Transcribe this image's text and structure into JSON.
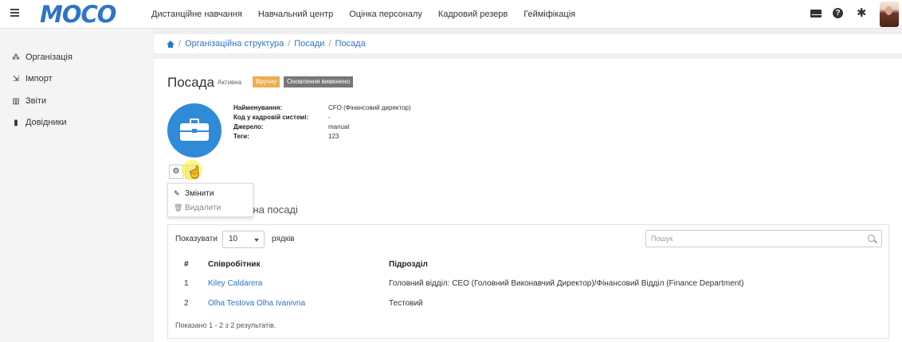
{
  "header": {
    "logo": "MOCO",
    "nav": [
      "Дистанційне навчання",
      "Навчальний центр",
      "Оцінка персоналу",
      "Кадровий резерв",
      "Гейміфікація"
    ],
    "help_glyph": "?",
    "gear_glyph": "✱"
  },
  "sidebar": {
    "items": [
      {
        "label": "Організація",
        "icon": "sitemap-icon",
        "glyph": "⁂"
      },
      {
        "label": "Імпорт",
        "icon": "import-icon",
        "glyph": "⇲"
      },
      {
        "label": "Звіти",
        "icon": "chart-icon",
        "glyph": "▥"
      },
      {
        "label": "Довідники",
        "icon": "book-icon",
        "glyph": "▮"
      }
    ]
  },
  "breadcrumb": {
    "items": [
      "Організаційна структура",
      "Посади",
      "Посада"
    ],
    "separator": "/"
  },
  "position": {
    "title": "Посада",
    "status": "Активна",
    "badge_manual": "Вручну",
    "badge_update": "Оновлення вимкнено",
    "fields": [
      {
        "label": "Найменування:",
        "value": "CFO (Фінансовий директор)"
      },
      {
        "label": "Код у кадровій системі:",
        "value": "-"
      },
      {
        "label": "Джерело:",
        "value": "manual"
      },
      {
        "label": "Теги:",
        "value": "123"
      }
    ]
  },
  "actions": {
    "gear_glyph": "⚙",
    "cursor_glyph": "☝",
    "edit_glyph": "✎",
    "delete_glyph": "🗑",
    "edit": "Змінити",
    "delete": "Видалити"
  },
  "employees": {
    "section_title": "ів на посаді",
    "show_label": "Показувати",
    "page_length": "10",
    "rows_label": "рядків",
    "search_placeholder": "Пошук",
    "columns": [
      "#",
      "Співробітник",
      "Підрозділ"
    ],
    "rows": [
      {
        "num": "1",
        "name": "Kiley Caldarera",
        "dept": "Головний відділ: CEO (Головний Виконавчий Директор)/Фінансовий Відділ (Finance Department)"
      },
      {
        "num": "2",
        "name": "Olha Testova Olha Ivanivna",
        "dept": "Тестовий"
      }
    ],
    "info": "Показано 1 - 2 з 2 результатів."
  },
  "colors": {
    "brand": "#2f74c6",
    "badge_manual": "#f0ad4e",
    "badge_update": "#777777",
    "avatar_bg": "#2f8bd8"
  }
}
